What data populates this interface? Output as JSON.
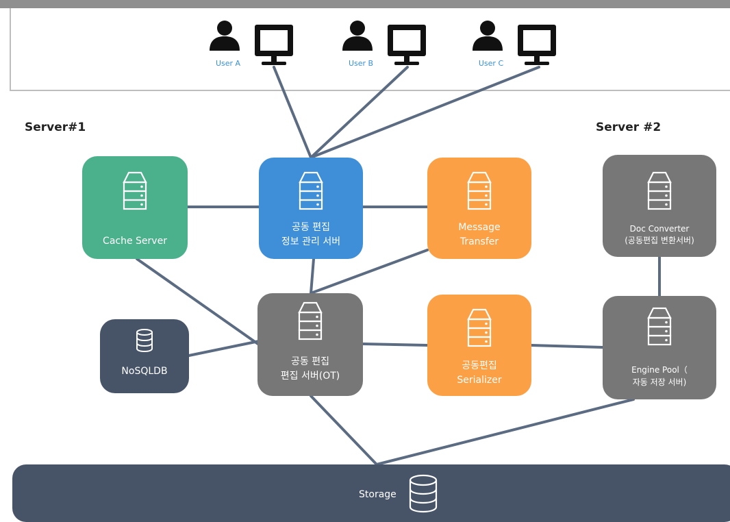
{
  "users": [
    {
      "label": "User A"
    },
    {
      "label": "User B"
    },
    {
      "label": "User C"
    }
  ],
  "servers": {
    "server1_label": "Server#1",
    "server2_label": "Server #2"
  },
  "nodes": {
    "cache_server": {
      "line1": "Cache Server"
    },
    "collab_info": {
      "line1": "공동 편집",
      "line2": "정보 관리 서버"
    },
    "message_transfer": {
      "line1": "Message",
      "line2": "Transfer"
    },
    "doc_converter": {
      "line1": "Doc Converter",
      "line2": "(공동편집 변환서버)"
    },
    "nosqldb": {
      "line1": "NoSQLDB"
    },
    "collab_edit": {
      "line1": "공동 편집",
      "line2": "편집 서버(OT)"
    },
    "serializer": {
      "line1": "공동편집",
      "line2": "Serializer"
    },
    "engine_pool": {
      "line1": "Engine Pool（",
      "line2": "자동 저장 서버)"
    },
    "storage": {
      "line1": "Storage"
    }
  },
  "colors": {
    "green": "#4bb08c",
    "blue": "#3e8fd7",
    "orange": "#fba044",
    "gray": "#777777",
    "navy": "#475468",
    "connector": "#5b6b82",
    "user_label": "#3a8fd6"
  }
}
